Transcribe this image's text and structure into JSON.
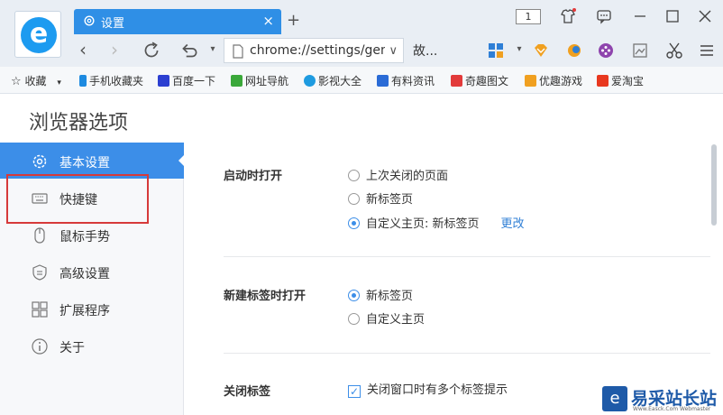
{
  "tab": {
    "title": "设置",
    "close": "×",
    "new": "+"
  },
  "window": {
    "badge": "1"
  },
  "address": {
    "url": "chrome://settings/gen",
    "extra": "故..."
  },
  "bookmarks": [
    {
      "label": "收藏",
      "icon": "star-icon",
      "color": "#555555"
    },
    {
      "label": "手机收藏夹",
      "icon": "phone-icon",
      "color": "#1d8ae0"
    },
    {
      "label": "百度一下",
      "icon": "baidu-icon",
      "color": "#2c3fd1"
    },
    {
      "label": "网址导航",
      "icon": "hao-icon",
      "color": "#3aa83a"
    },
    {
      "label": "影视大全",
      "icon": "video-icon",
      "color": "#1e9be0"
    },
    {
      "label": "有料资讯",
      "icon": "news-icon",
      "color": "#2a6bd6"
    },
    {
      "label": "奇趣图文",
      "icon": "qiqu-icon",
      "color": "#e23a3a"
    },
    {
      "label": "优趣游戏",
      "icon": "game-icon",
      "color": "#f0a020"
    },
    {
      "label": "爱淘宝",
      "icon": "taobao-icon",
      "color": "#e8381f"
    }
  ],
  "page": {
    "title": "浏览器选项"
  },
  "sidebar": {
    "items": [
      {
        "label": "基本设置",
        "icon": "gear-icon",
        "active": true
      },
      {
        "label": "快捷键",
        "icon": "keyboard-icon",
        "active": false
      },
      {
        "label": "鼠标手势",
        "icon": "mouse-icon",
        "active": false
      },
      {
        "label": "高级设置",
        "icon": "shield-icon",
        "active": false
      },
      {
        "label": "扩展程序",
        "icon": "puzzle-icon",
        "active": false
      },
      {
        "label": "关于",
        "icon": "info-icon",
        "active": false
      }
    ]
  },
  "startup": {
    "title": "启动时打开",
    "options": [
      "上次关闭的页面",
      "新标签页",
      "自定义主页: 新标签页"
    ],
    "selected": 2,
    "change_link": "更改"
  },
  "newtab": {
    "title": "新建标签时打开",
    "options": [
      "新标签页",
      "自定义主页"
    ],
    "selected": 0
  },
  "closetab": {
    "title": "关闭标签",
    "option": "关闭窗口时有多个标签提示",
    "checked": true
  },
  "watermark": {
    "title": "易采站长站",
    "sub": "Www.Easck.Com Webmaster"
  },
  "colors": {
    "accent": "#3c8ee8",
    "tab": "#2f8fe6",
    "highlight": "#d63a3a"
  }
}
